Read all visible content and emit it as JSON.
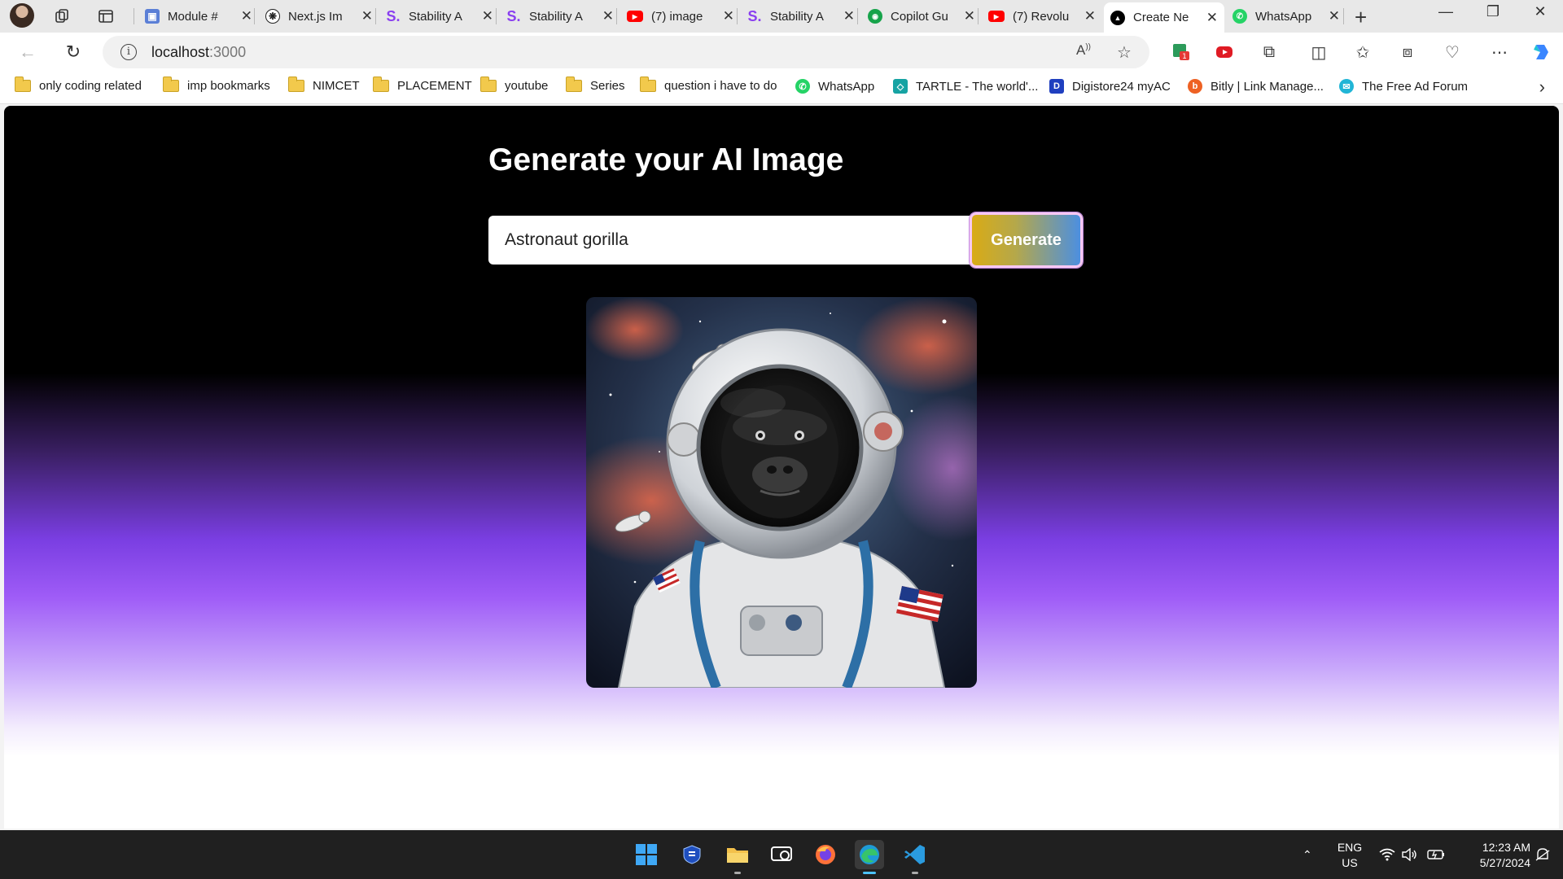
{
  "browser": {
    "tabs": [
      {
        "title": "Module #",
        "icon": "module-icon",
        "color": "#5b7fd6"
      },
      {
        "title": "Next.js Im",
        "icon": "chatgpt-icon",
        "color": "#222222"
      },
      {
        "title": "Stability A",
        "icon": "stability-icon",
        "color": "#8a3ff0"
      },
      {
        "title": "Stability A",
        "icon": "stability-icon",
        "color": "#8a3ff0"
      },
      {
        "title": "(7) image",
        "icon": "youtube-icon",
        "color": "#ff0000"
      },
      {
        "title": "Stability A",
        "icon": "stability-icon",
        "color": "#8a3ff0"
      },
      {
        "title": "Copilot Gu",
        "icon": "copilot-icon",
        "color": "#16a34a"
      },
      {
        "title": "(7) Revolu",
        "icon": "youtube-icon",
        "color": "#ff0000"
      },
      {
        "title": "Create Ne",
        "icon": "nextjs-icon",
        "color": "#000000",
        "active": true
      },
      {
        "title": "WhatsApp",
        "icon": "whatsapp-icon",
        "color": "#25d366"
      }
    ],
    "url_host": "localhost",
    "url_port": ":3000",
    "bookmarks": [
      {
        "label": "only coding  related",
        "type": "folder"
      },
      {
        "label": "imp bookmarks",
        "type": "folder"
      },
      {
        "label": "NIMCET",
        "type": "folder"
      },
      {
        "label": "PLACEMENT",
        "type": "folder"
      },
      {
        "label": "youtube",
        "type": "folder"
      },
      {
        "label": "Series",
        "type": "folder"
      },
      {
        "label": "question i have to do",
        "type": "folder"
      },
      {
        "label": "WhatsApp",
        "type": "site",
        "icon": "whatsapp-icon",
        "color": "#25d366"
      },
      {
        "label": "TARTLE - The world'...",
        "type": "site",
        "icon": "tartle-icon",
        "color": "#16a3a3"
      },
      {
        "label": "Digistore24 myAC",
        "type": "site",
        "icon": "digistore-icon",
        "color": "#1f3fbf"
      },
      {
        "label": "Bitly | Link Manage...",
        "type": "site",
        "icon": "bitly-icon",
        "color": "#ee6123"
      },
      {
        "label": "The Free Ad Forum",
        "type": "site",
        "icon": "adforum-icon",
        "color": "#21b5d6"
      }
    ]
  },
  "page": {
    "title": "Generate your AI Image",
    "prompt_value": "Astronaut gorilla",
    "generate_label": "Generate"
  },
  "taskbar": {
    "lang_line1": "ENG",
    "lang_line2": "US",
    "time": "12:23 AM",
    "date": "5/27/2024"
  },
  "colors": {
    "accent_gold": "#d9ab16",
    "accent_blue": "#4c8fe0",
    "gradient_purple": "#9f5cf7"
  }
}
